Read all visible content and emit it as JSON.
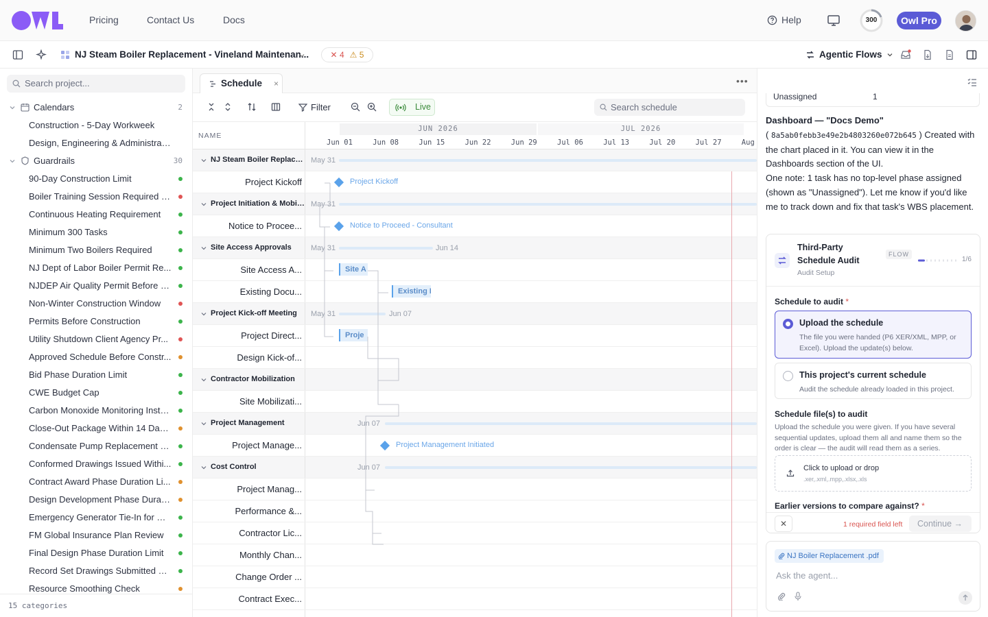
{
  "nav": {
    "links": [
      "Pricing",
      "Contact Us",
      "Docs"
    ],
    "help": "Help",
    "credits": "300",
    "pro": "Owl Pro"
  },
  "toolbar": {
    "project_title": "NJ Steam Boiler Replacement - Vineland Maintenan...",
    "errors": "4",
    "warnings": "5",
    "agentic": "Agentic Flows"
  },
  "sidebar": {
    "search_placeholder": "Search project...",
    "rows": [
      {
        "type": "cat",
        "label": "Calendars",
        "count": "2",
        "icon": "calendar-icon"
      },
      {
        "type": "item",
        "label": "Construction - 5-Day Workweek"
      },
      {
        "type": "item",
        "label": "Design, Engineering & Administrative"
      },
      {
        "type": "cat",
        "label": "Guardrails",
        "count": "30",
        "icon": "shield-icon"
      },
      {
        "type": "item",
        "label": "90-Day Construction Limit",
        "status": "green"
      },
      {
        "type": "item",
        "label": "Boiler Training Session Required B...",
        "status": "red"
      },
      {
        "type": "item",
        "label": "Continuous Heating Requirement",
        "status": "green"
      },
      {
        "type": "item",
        "label": "Minimum 300 Tasks",
        "status": "green"
      },
      {
        "type": "item",
        "label": "Minimum Two Boilers Required",
        "status": "green"
      },
      {
        "type": "item",
        "label": "NJ Dept of Labor Boiler Permit Re...",
        "status": "green"
      },
      {
        "type": "item",
        "label": "NJDEP Air Quality Permit Before C...",
        "status": "green"
      },
      {
        "type": "item",
        "label": "Non-Winter Construction Window",
        "status": "red"
      },
      {
        "type": "item",
        "label": "Permits Before Construction",
        "status": "green"
      },
      {
        "type": "item",
        "label": "Utility Shutdown Client Agency Pr...",
        "status": "red"
      },
      {
        "type": "item",
        "label": "Approved Schedule Before Constr...",
        "status": "orange"
      },
      {
        "type": "item",
        "label": "Bid Phase Duration Limit",
        "status": "green"
      },
      {
        "type": "item",
        "label": "CWE Budget Cap",
        "status": "green"
      },
      {
        "type": "item",
        "label": "Carbon Monoxide Monitoring Insta...",
        "status": "green"
      },
      {
        "type": "item",
        "label": "Close-Out Package Within 14 Days...",
        "status": "orange"
      },
      {
        "type": "item",
        "label": "Condensate Pump Replacement R...",
        "status": "green"
      },
      {
        "type": "item",
        "label": "Conformed Drawings Issued Withi...",
        "status": "green"
      },
      {
        "type": "item",
        "label": "Contract Award Phase Duration Li...",
        "status": "orange"
      },
      {
        "type": "item",
        "label": "Design Development Phase Durati...",
        "status": "orange"
      },
      {
        "type": "item",
        "label": "Emergency Generator Tie-In for Bo...",
        "status": "green"
      },
      {
        "type": "item",
        "label": "FM Global Insurance Plan Review",
        "status": "green"
      },
      {
        "type": "item",
        "label": "Final Design Phase Duration Limit",
        "status": "green"
      },
      {
        "type": "item",
        "label": "Record Set Drawings Submitted W...",
        "status": "green"
      },
      {
        "type": "item",
        "label": "Resource Smoothing Check",
        "status": "orange"
      }
    ],
    "footer": "15 categories"
  },
  "schedule": {
    "tab": "Schedule",
    "filter": "Filter",
    "live": "Live",
    "search_placeholder": "Search schedule",
    "name_header": "NAME",
    "months": [
      "JUN 2026",
      "JUL 2026"
    ],
    "weeks": [
      "Jun 01",
      "Jun 08",
      "Jun 15",
      "Jun 22",
      "Jun 29",
      "Jul 06",
      "Jul 13",
      "Jul 20",
      "Jul 27",
      "Aug"
    ],
    "rows": [
      {
        "type": "grp",
        "name": "NJ Steam Boiler Replace...",
        "start": "May 31"
      },
      {
        "type": "task",
        "name": "Project Kickoff",
        "milestone": "Project Kickoff"
      },
      {
        "type": "grp",
        "name": "Project Initiation & Mobili...",
        "start": "May 31"
      },
      {
        "type": "task",
        "name": "Notice to Procee...",
        "milestone": "Notice to Proceed - Consultant"
      },
      {
        "type": "grp",
        "name": "Site Access Approvals",
        "start": "May 31",
        "end": "Jun 14"
      },
      {
        "type": "task",
        "name": "Site Access A...",
        "bar": "Site A"
      },
      {
        "type": "task",
        "name": "Existing Docu...",
        "bar": "Existing D"
      },
      {
        "type": "grp",
        "name": "Project Kick-off Meeting",
        "start": "May 31",
        "end": "Jun 07"
      },
      {
        "type": "task",
        "name": "Project Direct...",
        "bar": "Proje"
      },
      {
        "type": "task",
        "name": "Design Kick-of..."
      },
      {
        "type": "grp",
        "name": "Contractor Mobilization"
      },
      {
        "type": "task",
        "name": "Site Mobilizati..."
      },
      {
        "type": "grp",
        "name": "Project Management",
        "start": "Jun 07"
      },
      {
        "type": "task",
        "name": "Project Manage...",
        "milestone": "Project Management Initiated"
      },
      {
        "type": "grp",
        "name": "Cost Control",
        "start": "Jun 07"
      },
      {
        "type": "task",
        "name": "Project Manag..."
      },
      {
        "type": "task",
        "name": "Performance &..."
      },
      {
        "type": "task",
        "name": "Contractor Lic..."
      },
      {
        "type": "task",
        "name": "Monthly Chan..."
      },
      {
        "type": "task",
        "name": "Change Order ..."
      },
      {
        "type": "task",
        "name": "Contract Exec..."
      }
    ]
  },
  "assistant": {
    "unassigned_label": "Unassigned",
    "unassigned_value": "1",
    "msg_heading": "Dashboard — \"Docs Demo\"",
    "msg_open": "( ",
    "msg_id": "8a5ab0febb3e49e2b4803260e072b645",
    "msg_rest": " ) Created with the chart placed in it. You can view it in the Dashboards section of the UI.",
    "msg_note": "One note: 1 task has no top-level phase assigned (shown as \"Unassigned\"). Let me know if you'd like me to track down and fix that task's WBS placement.",
    "flow": {
      "title": "Third-Party Schedule Audit",
      "tag": "FLOW",
      "step": "1/6",
      "step_fraction": 0.1667,
      "subtitle": "Audit Setup",
      "q1_label": "Schedule to audit",
      "options": [
        {
          "title": "Upload the schedule",
          "desc": "The file you were handed (P6 XER/XML, MPP, or Excel). Upload the update(s) below.",
          "selected": true
        },
        {
          "title": "This project's current schedule",
          "desc": "Audit the schedule already loaded in this project.",
          "selected": false
        }
      ],
      "q2_label": "Schedule file(s) to audit",
      "q2_help": "Upload the schedule you were given. If you have several sequential updates, upload them all and name them so the order is clear — the audit will read them as a series.",
      "upload_title": "Click to upload or drop",
      "upload_types": ".xer,.xml,.mpp,.xlsx,.xls",
      "q3_label": "Earlier versions to compare against?",
      "required_left": "1 required field left",
      "continue": "Continue"
    },
    "attachment": "NJ Boiler Replacement .pdf",
    "ask_placeholder": "Ask the agent..."
  }
}
